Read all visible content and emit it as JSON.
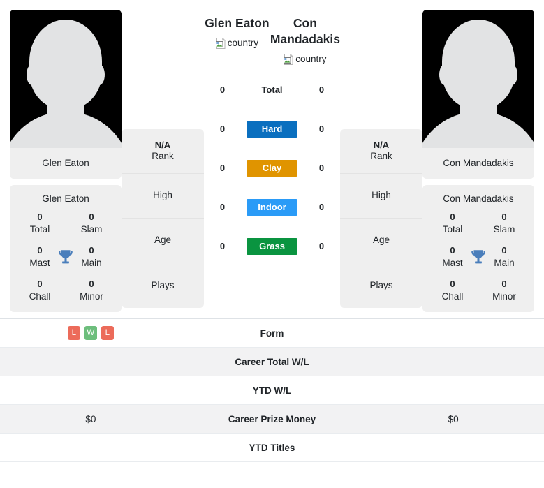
{
  "players": {
    "left": {
      "name": "Glen Eaton",
      "avatar_name": "Glen Eaton",
      "country_alt": "country",
      "trophy_title": "Glen Eaton",
      "titles": [
        {
          "num": "0",
          "label": "Total"
        },
        {
          "num": "0",
          "label": "Slam"
        },
        {
          "num": "0",
          "label": "Mast"
        },
        {
          "num": "0",
          "label": "Main"
        },
        {
          "num": "0",
          "label": "Chall"
        },
        {
          "num": "0",
          "label": "Minor"
        }
      ],
      "info": [
        {
          "value": "N/A",
          "key": "Rank"
        },
        {
          "value": "",
          "key": "High"
        },
        {
          "value": "",
          "key": "Age"
        },
        {
          "value": "",
          "key": "Plays"
        }
      ],
      "surface_counts": [
        "0",
        "0",
        "0",
        "0",
        "0"
      ]
    },
    "right": {
      "name": "Con Mandadakis",
      "avatar_name": "Con Mandadakis",
      "country_alt": "country",
      "trophy_title": "Con Mandadakis",
      "titles": [
        {
          "num": "0",
          "label": "Total"
        },
        {
          "num": "0",
          "label": "Slam"
        },
        {
          "num": "0",
          "label": "Mast"
        },
        {
          "num": "0",
          "label": "Main"
        },
        {
          "num": "0",
          "label": "Chall"
        },
        {
          "num": "0",
          "label": "Minor"
        }
      ],
      "info": [
        {
          "value": "N/A",
          "key": "Rank"
        },
        {
          "value": "",
          "key": "High"
        },
        {
          "value": "",
          "key": "Age"
        },
        {
          "value": "",
          "key": "Plays"
        }
      ],
      "surface_counts": [
        "0",
        "0",
        "0",
        "0",
        "0"
      ]
    }
  },
  "surfaces": [
    {
      "label": "Total",
      "color": "transparent",
      "plain": true
    },
    {
      "label": "Hard",
      "color": "#0a6fbf",
      "plain": false
    },
    {
      "label": "Clay",
      "color": "#e09400",
      "plain": false
    },
    {
      "label": "Indoor",
      "color": "#2a9bf7",
      "plain": false
    },
    {
      "label": "Grass",
      "color": "#0a9440",
      "plain": false
    }
  ],
  "table": {
    "rows": [
      {
        "label": "Form",
        "left_value": "",
        "right_value": "",
        "left_form": [
          "L",
          "W",
          "L"
        ],
        "right_form": []
      },
      {
        "label": "Career Total W/L",
        "left_value": "",
        "right_value": "",
        "left_form": [],
        "right_form": []
      },
      {
        "label": "YTD W/L",
        "left_value": "",
        "right_value": "",
        "left_form": [],
        "right_form": []
      },
      {
        "label": "Career Prize Money",
        "left_value": "$0",
        "right_value": "$0",
        "left_form": [],
        "right_form": []
      },
      {
        "label": "YTD Titles",
        "left_value": "",
        "right_value": "",
        "left_form": [],
        "right_form": []
      }
    ]
  },
  "colors": {
    "win": "#6dbe7c",
    "loss": "#ec6b5a",
    "trophy": "#4a7ebb",
    "card_bg": "#efefef",
    "row_alt": "#f2f2f3"
  }
}
